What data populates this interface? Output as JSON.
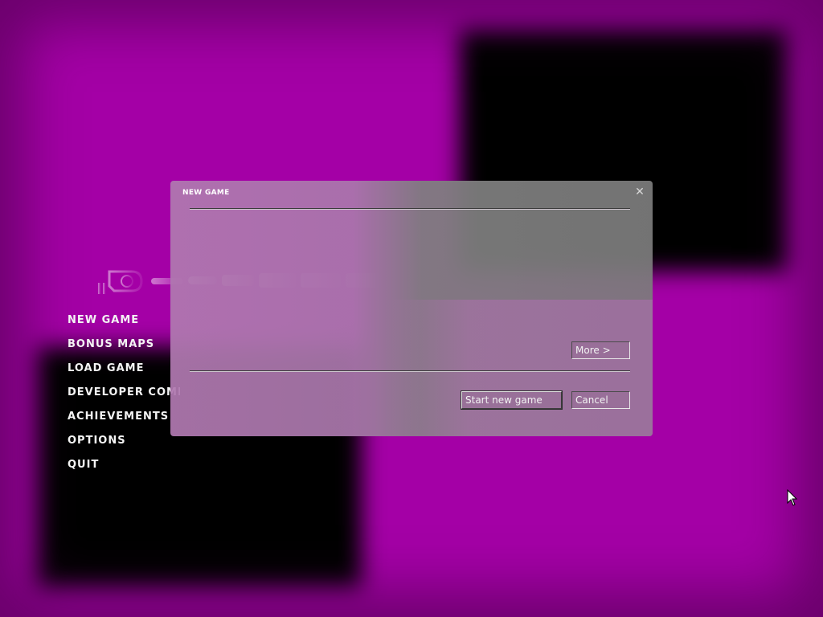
{
  "main_menu": {
    "items": [
      {
        "label": "NEW GAME"
      },
      {
        "label": "BONUS MAPS"
      },
      {
        "label": "LOAD GAME"
      },
      {
        "label": "DEVELOPER COMMENTARY"
      },
      {
        "label": "ACHIEVEMENTS"
      },
      {
        "label": "OPTIONS"
      },
      {
        "label": "QUIT"
      }
    ]
  },
  "dialog": {
    "title": "NEW GAME",
    "close_icon": "close-icon",
    "more_label": "More >",
    "start_label": "Start new game",
    "cancel_label": "Cancel"
  },
  "colors": {
    "background": "#a400a6",
    "missing_texture_block": "#000000",
    "dialog_gray": "#7c7c7c",
    "dialog_pink": "#b078b0",
    "text": "#f4f4f4"
  },
  "icons": {
    "logo": "game-logo",
    "cursor": "mouse-cursor-icon"
  }
}
